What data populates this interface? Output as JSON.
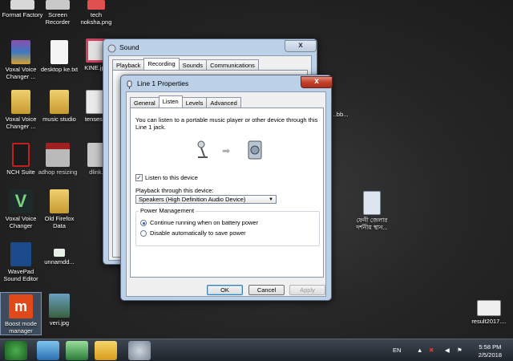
{
  "desktop_icons": [
    {
      "label": "Format Factory"
    },
    {
      "label": "Screen Recorder"
    },
    {
      "label": "tech noksha.png"
    },
    {
      "label": "Voxal Voice Changer ..."
    },
    {
      "label": "desktop ke.txt"
    },
    {
      "label": "KINE.jpg"
    },
    {
      "label": "Voxal Voice Changer ..."
    },
    {
      "label": "music studio"
    },
    {
      "label": "tenses..."
    },
    {
      "label": "NCH Suite"
    },
    {
      "label": "adhop resizing"
    },
    {
      "label": "dlink..."
    },
    {
      "label": "Voxal Voice Changer"
    },
    {
      "label": "Old Firefox Data"
    },
    {
      "label": "WavePad Sound Editor"
    },
    {
      "label": "unnamdd..."
    },
    {
      "label": "Boost mode manager"
    },
    {
      "label": "veri.jpg"
    },
    {
      "label": "ফেনী জেলার দর্শনীয় স্থান..."
    },
    {
      "label": "result2017...."
    },
    {
      "label": "..bb..."
    }
  ],
  "sound_window": {
    "title": "Sound",
    "tabs": [
      "Playback",
      "Recording",
      "Sounds",
      "Communications"
    ],
    "active_tab": "Recording",
    "close": "x"
  },
  "props_window": {
    "title": "Line 1 Properties",
    "close": "x",
    "tabs": [
      "General",
      "Listen",
      "Levels",
      "Advanced"
    ],
    "active_tab": "Listen",
    "description": "You can listen to a portable music player or other device through this Line 1 jack.",
    "listen_checkbox": {
      "label": "Listen to this device",
      "checked": true
    },
    "playback_label": "Playback through this device:",
    "playback_device": "Speakers (High Definition Audio Device)",
    "power_group": "Power Management",
    "radio_continue": "Continue running when on battery power",
    "radio_disable": "Disable automatically to save power",
    "ok": "OK",
    "cancel": "Cancel",
    "apply": "Apply"
  },
  "taskbar": {
    "lang": "EN",
    "time": "5:58 PM",
    "date": "2/5/2018"
  },
  "colors": {
    "start_orb": "#2a7a3a",
    "close_red": "#c2402a",
    "selection": "#3c7fb1"
  }
}
